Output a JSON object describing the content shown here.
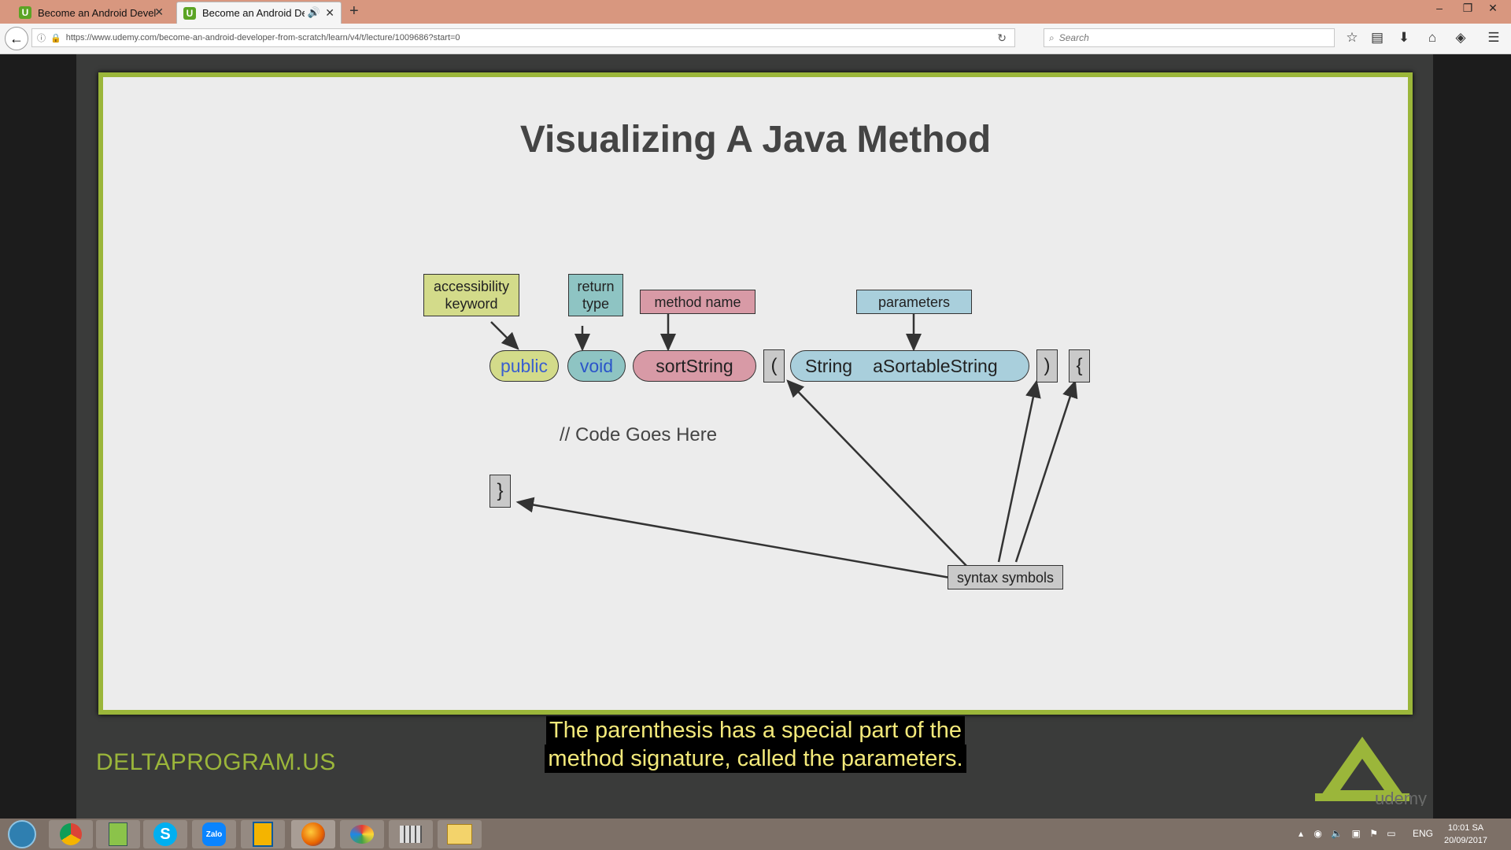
{
  "browser": {
    "tabs": [
      {
        "title": "Become an Android Develop",
        "favicon": "U",
        "active": false
      },
      {
        "title": "Become an Android Deve",
        "favicon": "U",
        "active": true
      }
    ],
    "new_tab": "+",
    "url": "https://www.udemy.com/become-an-android-developer-from-scratch/learn/v4/t/lecture/1009686?start=0",
    "search_placeholder": "Search",
    "window_controls": [
      "–",
      "❐",
      "✕"
    ]
  },
  "slide": {
    "title": "Visualizing A Java Method",
    "labels": {
      "accessibility": "accessibility keyword",
      "return_type": "return type",
      "method_name": "method name",
      "parameters": "parameters",
      "syntax": "syntax symbols"
    },
    "tokens": {
      "public": "public",
      "void": "void",
      "sort": "sortString",
      "open_paren": "(",
      "param_type": "String",
      "param_name": "aSortableString",
      "close_paren": ")",
      "open_brace": "{",
      "close_brace": "}"
    },
    "comment": "// Code Goes Here",
    "colors": {
      "accessibility": "#d3db8a",
      "return_type": "#8ec4c3",
      "method_name": "#d89aa6",
      "parameters": "#a9cfdc",
      "border": "#9bb63a"
    }
  },
  "subtitle": {
    "line1": "The parenthesis has a special part of the",
    "line2": "method signature, called the parameters."
  },
  "watermark": {
    "brand": "DELTAPROGRAM.US",
    "logo_text": "udemy"
  },
  "taskbar": {
    "apps": [
      "start-orb",
      "chrome",
      "notepad",
      "skype",
      "zalo",
      "mobile",
      "firefox",
      "paint",
      "calculator",
      "explorer"
    ],
    "language": "ENG",
    "time": "10:01 SA",
    "date": "20/09/2017"
  }
}
